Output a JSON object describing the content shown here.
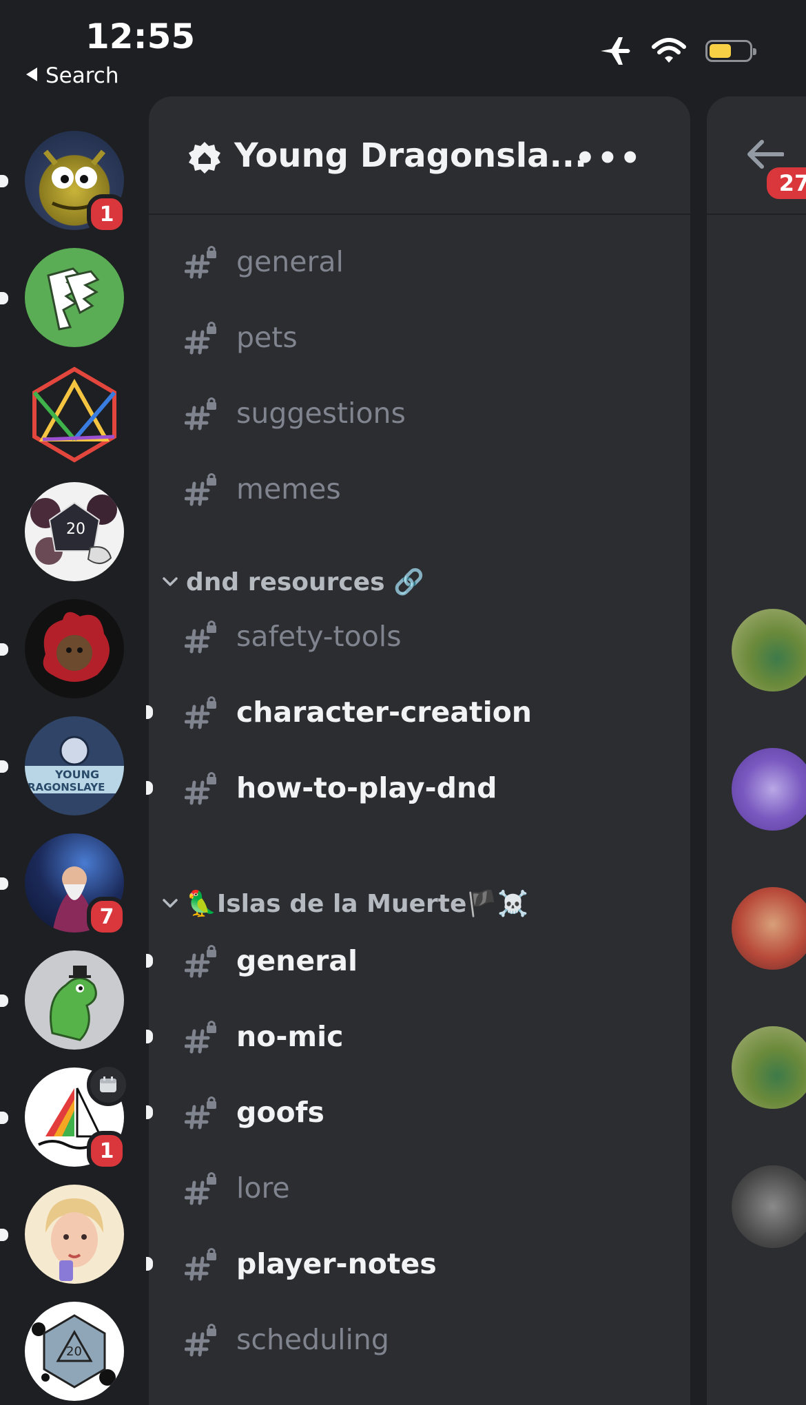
{
  "status_bar": {
    "time": "12:55",
    "back_label": "Search",
    "icons": [
      "airplane-icon",
      "wifi-icon",
      "battery-icon"
    ],
    "battery_level": 0.45
  },
  "server_rail": {
    "servers": [
      {
        "name": "dragon-server",
        "badge": "1"
      },
      {
        "name": "cards-server"
      },
      {
        "name": "rainbow-dice-server"
      },
      {
        "name": "d20-flowers-server"
      },
      {
        "name": "flame-cat-server"
      },
      {
        "name": "young-dragonslayers-server"
      },
      {
        "name": "wizard-server",
        "badge": "7"
      },
      {
        "name": "dino-server"
      },
      {
        "name": "rainbow-sail-server",
        "badge": "1",
        "event_icon": "calendar-icon"
      },
      {
        "name": "portrait-server"
      },
      {
        "name": "d20-splatter-server"
      }
    ]
  },
  "panel": {
    "server_name": "Young Dragonsla...",
    "more_label": "•••",
    "channels_top": [
      {
        "name": "general",
        "unread": false
      },
      {
        "name": "pets",
        "unread": false
      },
      {
        "name": "suggestions",
        "unread": false
      },
      {
        "name": "memes",
        "unread": false
      }
    ],
    "category_1": {
      "label": "dnd resources 🔗"
    },
    "channels_cat1": [
      {
        "name": "safety-tools",
        "unread": false
      },
      {
        "name": "character-creation",
        "unread": true
      },
      {
        "name": "how-to-play-dnd",
        "unread": true
      }
    ],
    "category_2": {
      "label": "🦜Islas de la Muerte🏴☠️"
    },
    "channels_cat2": [
      {
        "name": "general",
        "unread": true
      },
      {
        "name": "no-mic",
        "unread": true
      },
      {
        "name": "goofs",
        "unread": true
      },
      {
        "name": "lore",
        "unread": false
      },
      {
        "name": "player-notes",
        "unread": true
      },
      {
        "name": "scheduling",
        "unread": false
      }
    ]
  },
  "peek": {
    "badge": "27"
  },
  "colors": {
    "background": "#1e1f22",
    "panel": "#2b2d31",
    "badge_red": "#da373c",
    "muted_text": "#80848e",
    "bright_text": "#f2f3f5"
  }
}
